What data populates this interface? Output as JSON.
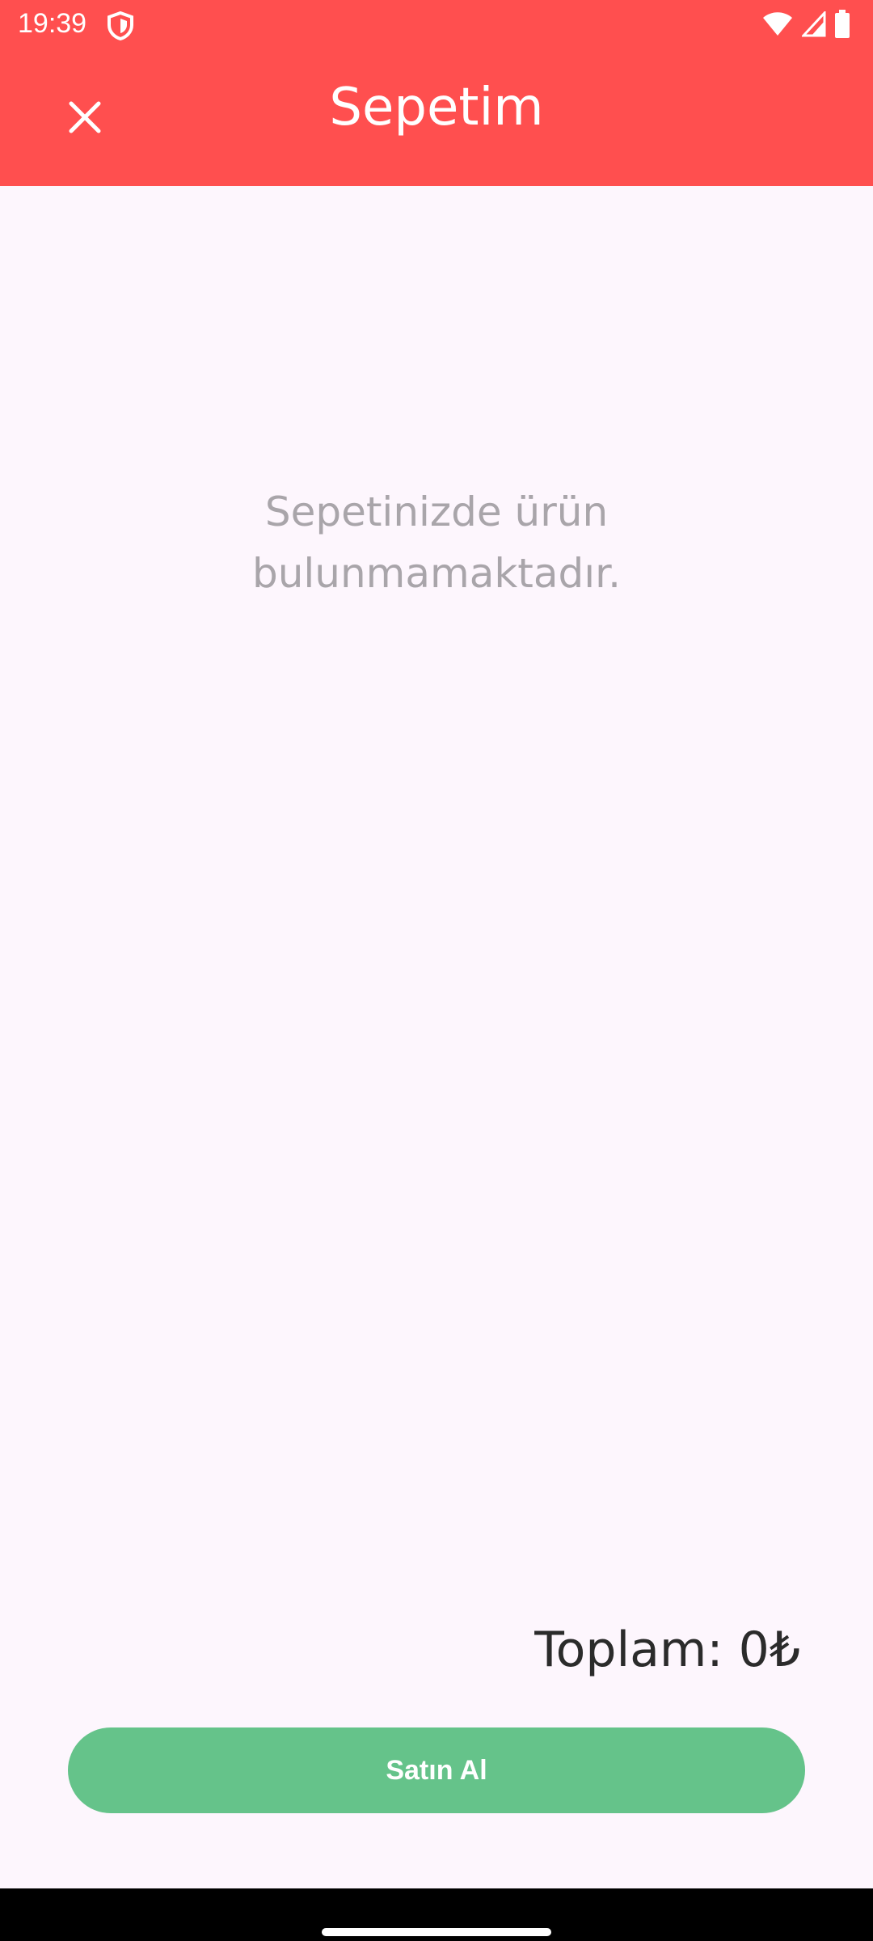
{
  "status_bar": {
    "time": "19:39"
  },
  "header": {
    "title": "Sepetim",
    "background_color": "#ff4f4f"
  },
  "cart": {
    "empty_message": "Sepetinizde ürün bulunmamaktadır.",
    "total_label": "Toplam: 0₺"
  },
  "buy_button": {
    "label": "Satın Al",
    "color": "#65c38a"
  },
  "icons": {
    "close": "close-icon",
    "shield": "shield-icon",
    "wifi": "wifi-icon",
    "signal": "signal-icon",
    "battery": "battery-icon"
  }
}
